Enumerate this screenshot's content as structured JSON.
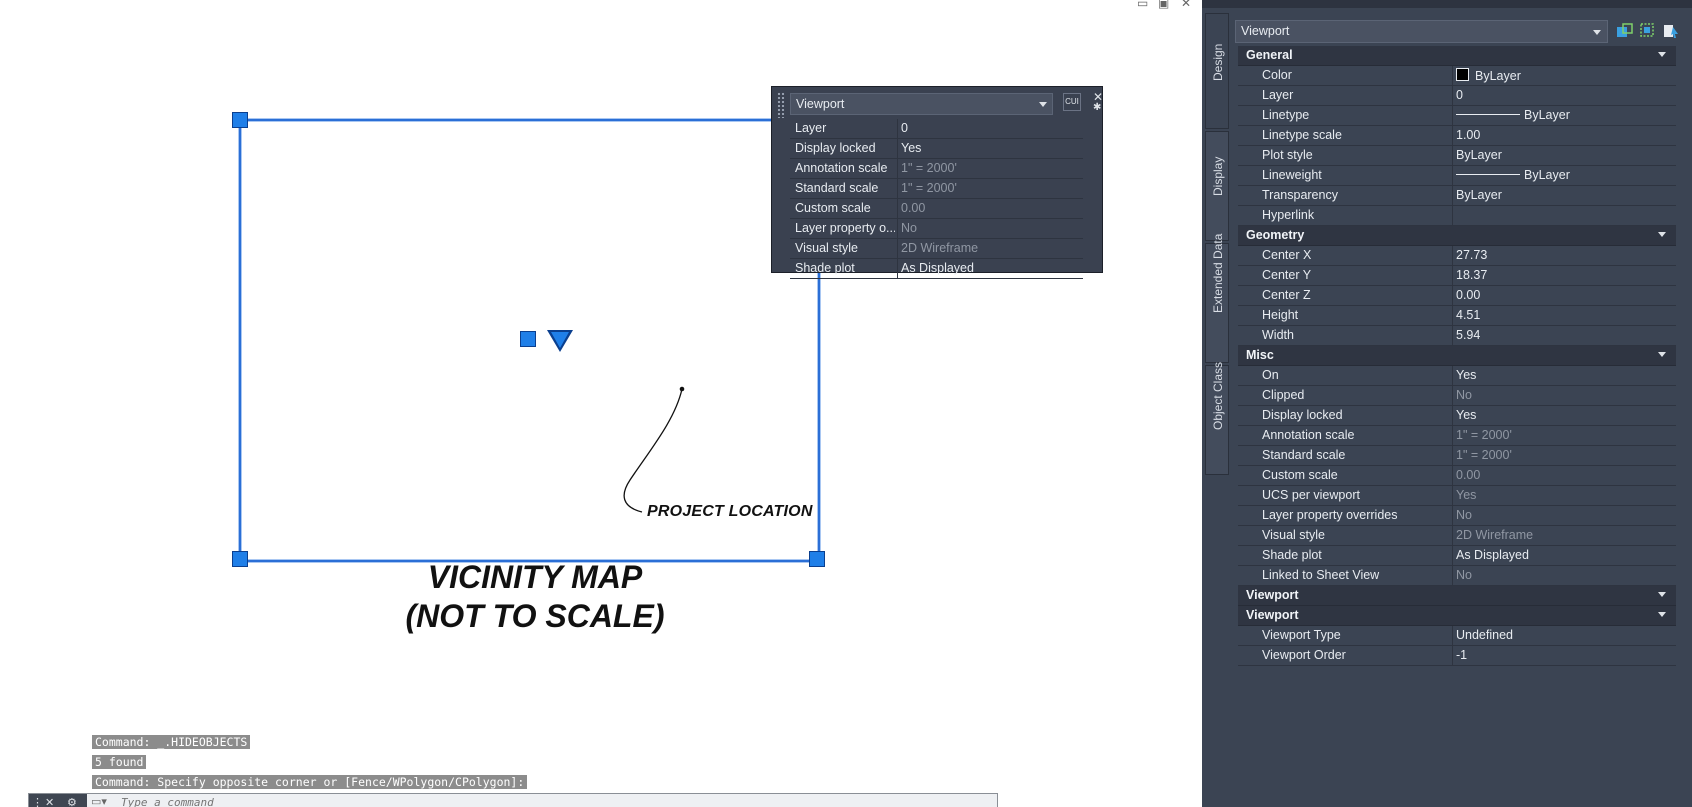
{
  "window_controls": {
    "minimize": "▭",
    "restore": "▣",
    "close": "✕"
  },
  "drawing": {
    "project_location": "PROJECT LOCATION",
    "title_line1": "VICINITY MAP",
    "title_line2": "(NOT TO SCALE)"
  },
  "command": {
    "history": [
      "Command: _.HIDEOBJECTS",
      "5 found",
      "Command: Specify opposite corner or [Fence/WPolygon/CPolygon]:"
    ],
    "close_glyph": "✕",
    "wrench_glyph": "⚙",
    "placeholder": "Type a command"
  },
  "quick_properties": {
    "object_type": "Viewport",
    "button_label": "CUI",
    "close_glyph": "✕",
    "options_glyph": "✱",
    "rows": [
      {
        "key": "Layer",
        "value": "0",
        "dim": false
      },
      {
        "key": "Display locked",
        "value": "Yes",
        "dim": false
      },
      {
        "key": "Annotation scale",
        "value": "1\" = 2000'",
        "dim": true
      },
      {
        "key": "Standard scale",
        "value": "1\" = 2000'",
        "dim": true
      },
      {
        "key": "Custom scale",
        "value": "0.00",
        "dim": true
      },
      {
        "key": "Layer property o...",
        "value": "No",
        "dim": true
      },
      {
        "key": "Visual style",
        "value": "2D Wireframe",
        "dim": true
      },
      {
        "key": "Shade plot",
        "value": "As Displayed",
        "dim": false
      }
    ]
  },
  "properties_palette": {
    "object_type": "Viewport",
    "tabs": [
      "Design",
      "Display",
      "Extended Data",
      "Object Class"
    ],
    "general": {
      "title": "General",
      "rows": [
        {
          "key": "Color",
          "value": "ByLayer"
        },
        {
          "key": "Layer",
          "value": "0"
        },
        {
          "key": "Linetype",
          "value": "ByLayer"
        },
        {
          "key": "Linetype scale",
          "value": "1.00"
        },
        {
          "key": "Plot style",
          "value": "ByLayer"
        },
        {
          "key": "Lineweight",
          "value": "ByLayer"
        },
        {
          "key": "Transparency",
          "value": "ByLayer"
        },
        {
          "key": "Hyperlink",
          "value": ""
        }
      ]
    },
    "geometry": {
      "title": "Geometry",
      "rows": [
        {
          "key": "Center X",
          "value": "27.73"
        },
        {
          "key": "Center Y",
          "value": "18.37"
        },
        {
          "key": "Center Z",
          "value": "0.00"
        },
        {
          "key": "Height",
          "value": "4.51"
        },
        {
          "key": "Width",
          "value": "5.94"
        }
      ]
    },
    "misc": {
      "title": "Misc",
      "rows": [
        {
          "key": "On",
          "value": "Yes",
          "dim": false
        },
        {
          "key": "Clipped",
          "value": "No",
          "dim": true
        },
        {
          "key": "Display locked",
          "value": "Yes",
          "dim": false
        },
        {
          "key": "Annotation scale",
          "value": "1\" = 2000'",
          "dim": true
        },
        {
          "key": "Standard scale",
          "value": "1\" = 2000'",
          "dim": true
        },
        {
          "key": "Custom scale",
          "value": "0.00",
          "dim": true
        },
        {
          "key": "UCS per viewport",
          "value": "Yes",
          "dim": true
        },
        {
          "key": "Layer property overrides",
          "value": "No",
          "dim": true
        },
        {
          "key": "Visual style",
          "value": "2D Wireframe",
          "dim": true
        },
        {
          "key": "Shade plot",
          "value": "As Displayed",
          "dim": false
        },
        {
          "key": "Linked to Sheet View",
          "value": "No",
          "dim": true
        }
      ]
    },
    "viewport_cat_1": "Viewport",
    "viewport_cat_2": "Viewport",
    "viewport_rows": [
      {
        "key": "Viewport Type",
        "value": "Undefined"
      },
      {
        "key": "Viewport Order",
        "value": "-1"
      }
    ]
  },
  "colors": {
    "grip_blue": "#1f7fe8",
    "palette_bg": "#3b4453",
    "accent_icon": "#3aa0e0"
  }
}
